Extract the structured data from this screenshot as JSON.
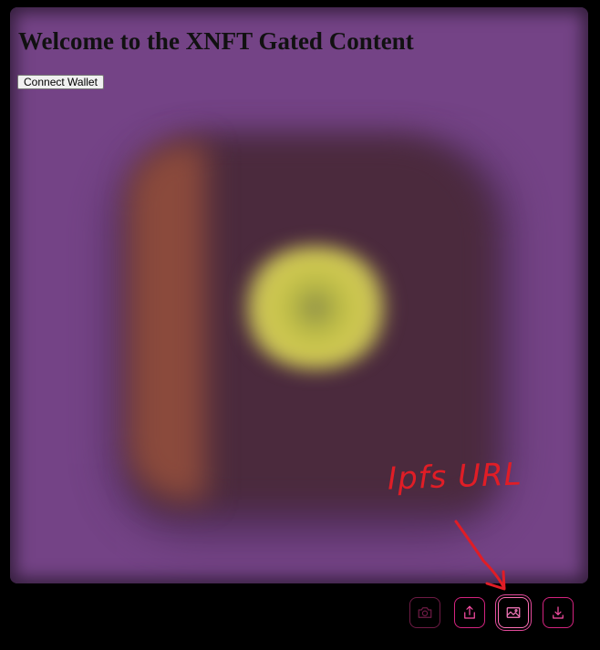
{
  "page": {
    "heading": "Welcome to the XNFT Gated Content",
    "connect_button_label": "Connect Wallet"
  },
  "annotation": {
    "text": "Ipfs URL",
    "color": "#e01d26"
  },
  "toolbar": {
    "buttons": [
      {
        "icon": "camera-icon",
        "state": "disabled"
      },
      {
        "icon": "share-icon",
        "state": "enabled"
      },
      {
        "icon": "image-icon",
        "state": "active"
      },
      {
        "icon": "download-icon",
        "state": "enabled"
      }
    ]
  },
  "colors": {
    "background": "#744386",
    "accent": "#d4237f"
  }
}
